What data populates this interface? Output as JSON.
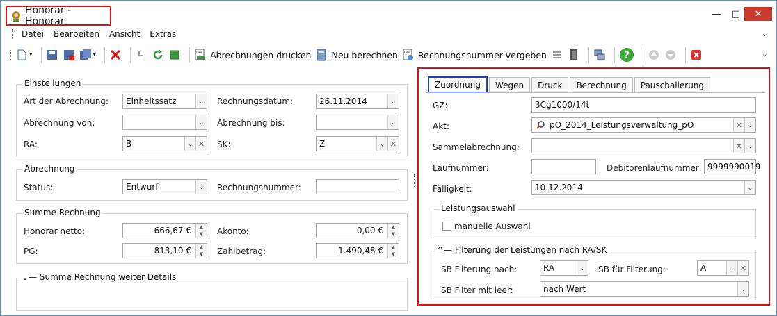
{
  "window": {
    "title": "Honorar - Honorar",
    "min": "—",
    "max": "□",
    "close": "✕"
  },
  "menu": [
    "Datei",
    "Bearbeiten",
    "Ansicht",
    "Extras"
  ],
  "toolbar": {
    "print_label": "Abrechnungen drucken",
    "recalc_label": "Neu berechnen",
    "invoice_no_label": "Rechnungsnummer vergeben"
  },
  "settings": {
    "title": "Einstellungen",
    "art_label": "Art der Abrechnung:",
    "art_value": "Einheitssatz",
    "rdate_label": "Rechnungsdatum:",
    "rdate_value": "26.11.2014",
    "from_label": "Abrechnung von:",
    "from_value": "",
    "to_label": "Abrechnung bis:",
    "to_value": "",
    "ra_label": "RA:",
    "ra_value": "B",
    "sk_label": "SK:",
    "sk_value": "Z"
  },
  "billing": {
    "title": "Abrechnung",
    "status_label": "Status:",
    "status_value": "Entwurf",
    "invno_label": "Rechnungsnummer:",
    "invno_value": ""
  },
  "sum": {
    "title": "Summe Rechnung",
    "net_label": "Honorar netto:",
    "net_value": "666,67 €",
    "akonto_label": "Akonto:",
    "akonto_value": "0,00 €",
    "pg_label": "PG:",
    "pg_value": "813,10 €",
    "pay_label": "Zahlbetrag:",
    "pay_value": "1.490,48 €"
  },
  "details": {
    "title": "Summe Rechnung weiter Details"
  },
  "tabs": [
    "Zuordnung",
    "Wegen",
    "Druck",
    "Berechnung",
    "Pauschalierung"
  ],
  "assign": {
    "gz_label": "GZ:",
    "gz_value": "3Cg1000/14t",
    "akt_label": "Akt:",
    "akt_value": "pO_2014_Leistungsverwaltung_pO",
    "sammel_label": "Sammelabrechnung:",
    "sammel_value": "",
    "lauf_label": "Laufnummer:",
    "lauf_value": "",
    "deb_label": "Debitorenlaufnummer:",
    "deb_value": "9999990019",
    "faell_label": "Fälligkeit:",
    "faell_value": "10.12.2014",
    "leist_title": "Leistungsauswahl",
    "manual_label": "manuelle Auswahl",
    "filter_title": "Filterung der Leistungen nach RA/SK",
    "sbf_label": "SB Filterung nach:",
    "sbf_value": "RA",
    "sbfor_label": "SB für Filterung:",
    "sbfor_value": "A",
    "sbleer_label": "SB Filter mit leer:",
    "sbleer_value": "nach Wert"
  },
  "colors": {
    "highlight_red": "#dd1111",
    "tab_blue": "#1a3fd1",
    "close_red": "#c93b2d"
  }
}
